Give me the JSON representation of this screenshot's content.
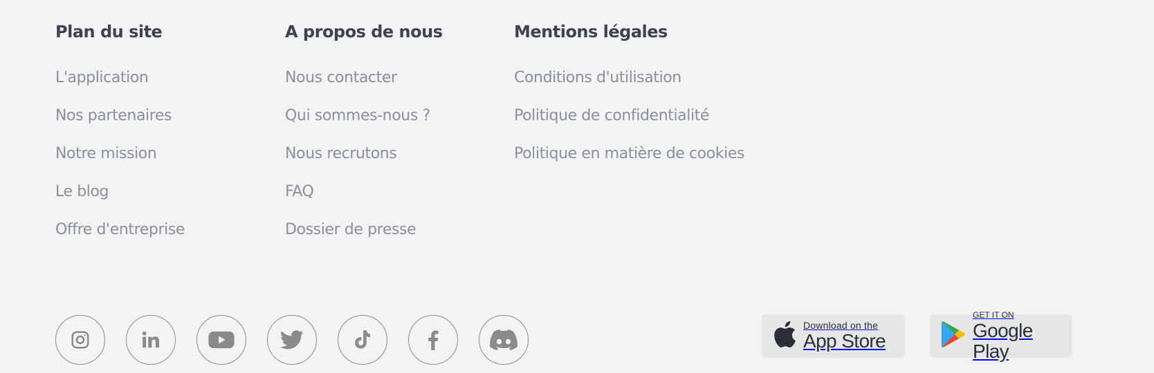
{
  "columns": [
    {
      "title": "Plan du site",
      "links": [
        "L'application",
        "Nos partenaires",
        "Notre mission",
        "Le blog",
        "Offre d'entreprise"
      ]
    },
    {
      "title": "A propos de nous",
      "links": [
        "Nous contacter",
        "Qui sommes-nous ?",
        "Nous recrutons",
        "FAQ",
        "Dossier de presse"
      ]
    },
    {
      "title": "Mentions légales",
      "links": [
        "Conditions d'utilisation",
        "Politique de confidentialité",
        "Politique en matière de cookies"
      ]
    }
  ],
  "social": [
    {
      "icon": "instagram-icon"
    },
    {
      "icon": "linkedin-icon"
    },
    {
      "icon": "youtube-icon"
    },
    {
      "icon": "twitter-icon"
    },
    {
      "icon": "tiktok-icon"
    },
    {
      "icon": "facebook-icon"
    },
    {
      "icon": "discord-icon"
    }
  ],
  "stores": {
    "apple": {
      "small": "Download on the",
      "big": "App Store",
      "icon": "apple-icon"
    },
    "google": {
      "small": "GET IT ON",
      "big": "Google Play",
      "icon": "google-play-icon"
    }
  },
  "colors": {
    "background": "#f2f3f5",
    "heading": "#3f4350",
    "link": "#8b9097",
    "icon": "#8a8a8a",
    "store_bg": "#e5e6e8"
  }
}
